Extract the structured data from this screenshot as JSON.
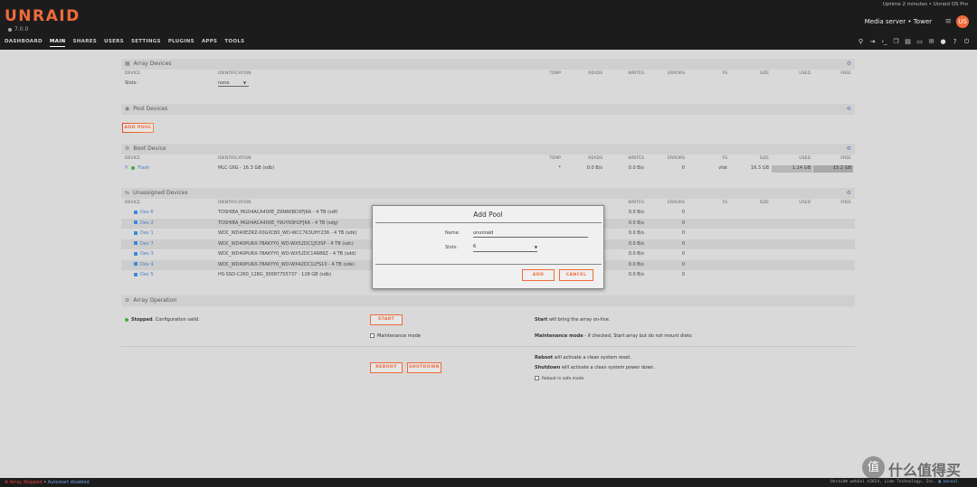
{
  "header": {
    "logo": "UNRAID",
    "version": "7.0.0",
    "uptime": "Uptime 2 minutes  •  Unraid OS Pro",
    "server": "Media server  •  Tower",
    "avatar_initials": "US",
    "nav_tabs": [
      "DASHBOARD",
      "MAIN",
      "SHARES",
      "USERS",
      "SETTINGS",
      "PLUGINS",
      "APPS",
      "TOOLS"
    ],
    "active_tab": "MAIN",
    "tool_icons": [
      "search-icon",
      "login-icon",
      "terminal-icon",
      "copy-icon",
      "log-icon",
      "screen-icon",
      "feedback-icon",
      "info-icon",
      "help-icon",
      "power-icon"
    ]
  },
  "columns": {
    "device": "DEVICE",
    "identification": "IDENTIFICATION",
    "temp": "TEMP",
    "reads": "READS",
    "writes": "WRITES",
    "errors": "ERRORS",
    "fs": "FS",
    "size": "SIZE",
    "used": "USED",
    "free": "FREE"
  },
  "array_devices": {
    "title": "Array Devices",
    "slots_label": "Slots:",
    "slots_value": "none"
  },
  "pool_devices": {
    "title": "Pool Devices",
    "add_pool_label": "ADD POOL"
  },
  "boot_device": {
    "title": "Boot Device",
    "row": {
      "device": "Flash",
      "identification": "MLC-16G - 16.3 GB (sdb)",
      "temp": "*",
      "reads": "0.0 B/s",
      "writes": "0.0 B/s",
      "errors": "0",
      "fs": "vfat",
      "size": "16.3 GB",
      "used": "1.14 GB",
      "free": "15.2 GB"
    }
  },
  "unassigned_devices": {
    "title": "Unassigned Devices",
    "rows": [
      {
        "device": "Dev 6",
        "identification": "TOSHIBA_MG04ACA400E_Z9N6KBDXFJKA - 4 TB (sdf)",
        "writes": "0.0 B/s",
        "errors": "0"
      },
      {
        "device": "Dev 2",
        "identification": "TOSHIBA_MG04ACA400E_Y9UYK9H2FJKA - 4 TB (sdg)",
        "writes": "0.0 B/s",
        "errors": "0"
      },
      {
        "device": "Dev 1",
        "identification": "WDC_WD40EZRZ-00GXCB0_WD-WCC7K3UHY236 - 4 TB (sdk)",
        "writes": "0.0 B/s",
        "errors": "0"
      },
      {
        "device": "Dev 7",
        "identification": "WDC_WD40PURX-78AKYY0_WD-WX52DC1J53SP - 4 TB (sdc)",
        "writes": "0.0 B/s",
        "errors": "0"
      },
      {
        "device": "Dev 3",
        "identification": "WDC_WD40PURX-78AKYY0_WD-WX52DC14R86Z - 4 TB (sdd)",
        "writes": "0.0 B/s",
        "errors": "0"
      },
      {
        "device": "Dev 4",
        "identification": "WDC_WD40PURX-78AKYY0_WD-WX42DC1LFS10 - 4 TB (sde)",
        "writes": "0.0 B/s",
        "errors": "0"
      },
      {
        "device": "Dev 5",
        "identification": "HS-SSD-C260_128G_30087755737 - 128 GB (sdb)",
        "writes": "0.0 B/s",
        "errors": "0"
      }
    ]
  },
  "array_operation": {
    "title": "Array Operation",
    "status_bold": "Stopped",
    "status_rest": ". Configuration valid.",
    "start_label": "START",
    "maintenance_label": "Maintenance mode",
    "start_desc_bold": "Start",
    "start_desc": " will bring the array on-line.",
    "maint_desc_bold": "Maintenance mode",
    "maint_desc": " - if checked, Start array but do not mount disks",
    "reboot_label": "REBOOT",
    "shutdown_label": "SHUTDOWN",
    "reboot_desc_bold": "Reboot",
    "reboot_desc": " will activate a clean system reset.",
    "shutdown_desc_bold": "Shutdown",
    "shutdown_desc": " will activate a clean system power down.",
    "safe_mode_label": "Reboot in safe mode"
  },
  "modal": {
    "title": "Add Pool",
    "name_label": "Name:",
    "name_value": "ununraid",
    "slots_label": "Slots:",
    "slots_value": "6",
    "add_label": "ADD",
    "cancel_label": "CANCEL"
  },
  "footer": {
    "array_status": "Array Stopped",
    "separator": " • ",
    "autostart": "Autostart disabled",
    "copyright": "Unraid® webGui ©2024, Lime Technology, Inc.",
    "manual": "manual"
  },
  "watermark": {
    "badge": "值",
    "text": "什么值得买"
  },
  "colors": {
    "accent": "#ef6b3a",
    "header_bg": "#1c1c1c",
    "content_bg": "#d9d9d9",
    "status_green": "#3cb043",
    "device_blue": "#3a8bd8",
    "stopped_red": "#e0433a"
  }
}
